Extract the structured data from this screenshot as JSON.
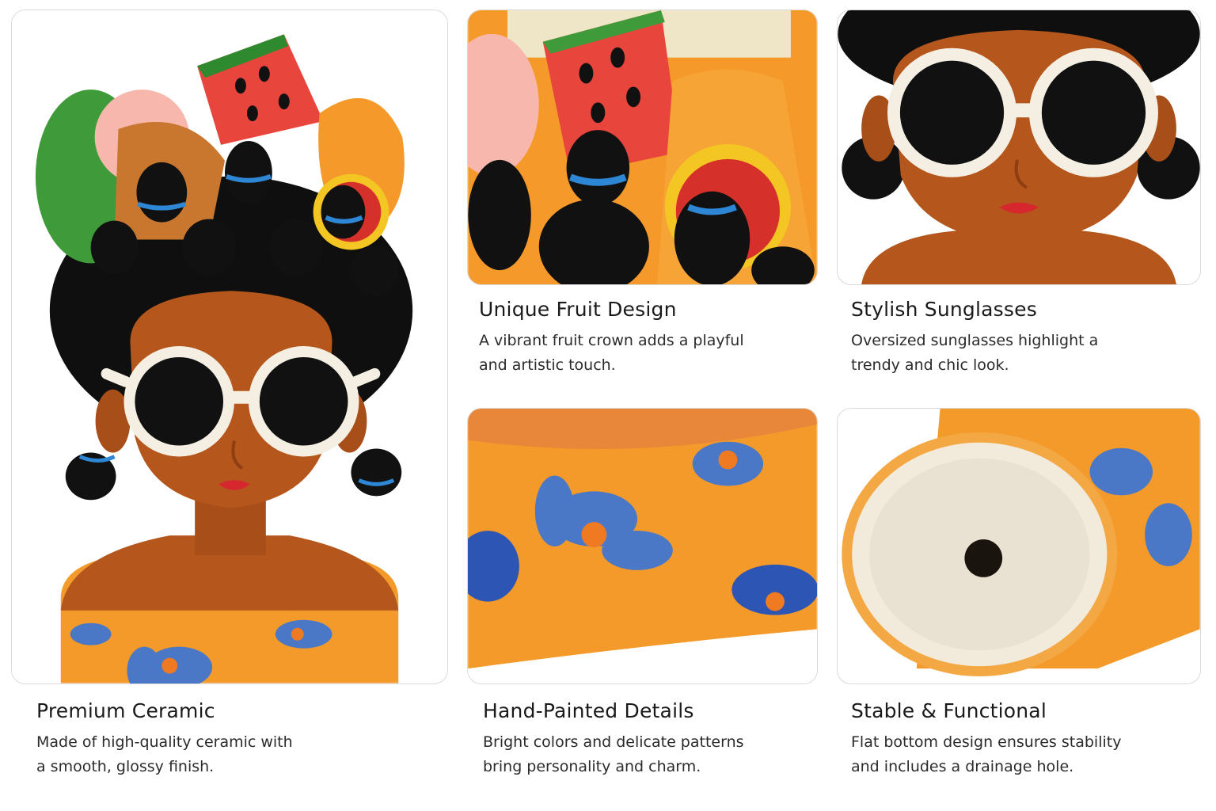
{
  "features": {
    "premium_ceramic": {
      "title": "Premium Ceramic",
      "description": "Made of high-quality ceramic with\na smooth, glossy finish."
    },
    "fruit_design": {
      "title": "Unique Fruit Design",
      "description": "A vibrant fruit crown adds a playful\nand artistic touch."
    },
    "sunglasses": {
      "title": "Stylish Sunglasses",
      "description": "Oversized sunglasses highlight a\ntrendy and chic look."
    },
    "hand_painted": {
      "title": "Hand-Painted Details",
      "description": "Bright colors and delicate patterns\nbring personality and charm."
    },
    "stable": {
      "title": "Stable & Functional",
      "description": "Flat bottom design ensures stability\nand includes a drainage hole."
    }
  },
  "colors": {
    "skin": "#b5561c",
    "hair": "#0f0f0f",
    "orange_body": "#f39a2b",
    "flower_blue": "#4a78c7",
    "frame_white": "#f4efe2",
    "watermelon": "#e8453c",
    "leaf_green": "#3f9b3a"
  },
  "icons": [
    "ceramic-planter-photo",
    "fruit-crown-photo",
    "sunglasses-photo",
    "painted-pattern-photo",
    "planter-bottom-photo"
  ]
}
